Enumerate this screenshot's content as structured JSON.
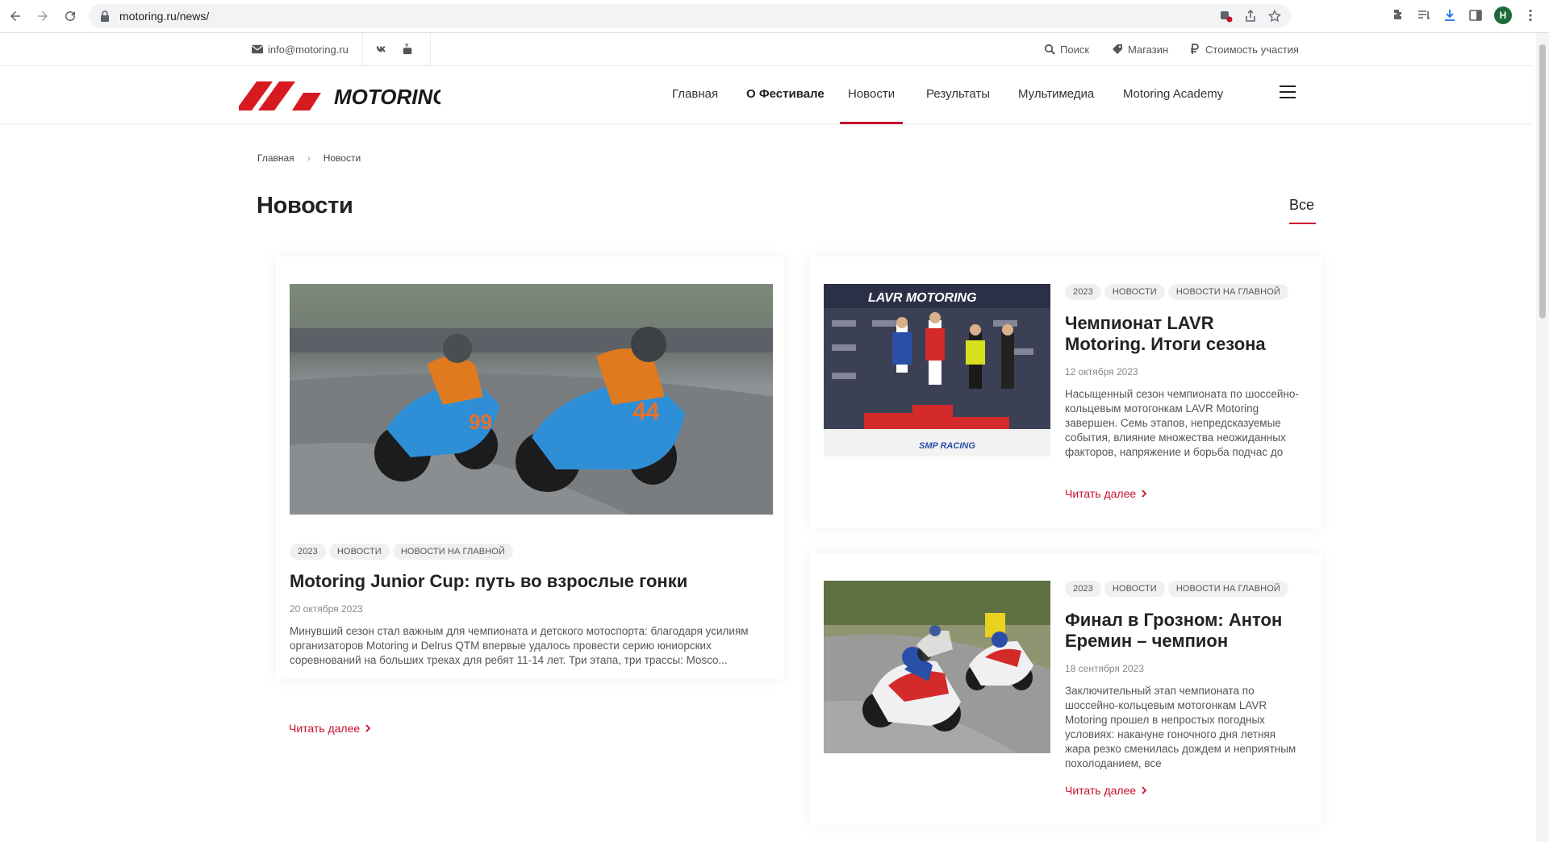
{
  "browser": {
    "url": "motoring.ru/news/",
    "profile_initial": "H"
  },
  "topbar": {
    "email": "info@motoring.ru",
    "search_label": "Поиск",
    "shop_label": "Магазин",
    "price_label": "Стоимость участия"
  },
  "header": {
    "logo_text": "MOTORING",
    "menu": [
      {
        "label": "Главная"
      },
      {
        "label": "О Фестивале"
      },
      {
        "label": "Новости"
      },
      {
        "label": "Результаты"
      },
      {
        "label": "Мультимедиа"
      },
      {
        "label": "Motoring Academy"
      }
    ]
  },
  "breadcrumb": {
    "home": "Главная",
    "separator": "›",
    "current": "Новости"
  },
  "page": {
    "title": "Новости",
    "filter_label": "Все"
  },
  "news": [
    {
      "tags": [
        "2023",
        "НОВОСТИ",
        "НОВОСТИ НА ГЛАВНОЙ"
      ],
      "title": "Motoring Junior Cup: путь во взрослые гонки",
      "date": "20 октября 2023",
      "text": "Минувший сезон стал важным для чемпионата и детского мотоспорта: благодаря усилиям организаторов Motoring и Delrus QTM впервые удалось провести серию юниорских соревнований на больших треках для ребят 11-14 лет. Три этапа, три трассы: Mosco...",
      "read_more": "Читать далее"
    },
    {
      "tags": [
        "2023",
        "НОВОСТИ",
        "НОВОСТИ НА ГЛАВНОЙ"
      ],
      "title": "Чемпионат LAVR Motoring. Итоги сезона",
      "date": "12 октября 2023",
      "text": "Насыщенный сезон чемпионата по шоссейно-кольцевым мотогонкам LAVR Motoring завершен. Семь этапов, непредсказуемые события, влияние множества неожиданных факторов, напряжение и борьба подчас до",
      "read_more": "Читать далее"
    },
    {
      "tags": [
        "2023",
        "НОВОСТИ",
        "НОВОСТИ НА ГЛАВНОЙ"
      ],
      "title": "Финал в Грозном: Антон Еремин – чемпион",
      "date": "18 сентября 2023",
      "text": "Заключительный этап чемпионата по шоссейно-кольцевым мотогонкам LAVR Motoring прошел в непростых погодных условиях: накануне гоночного дня летняя жара резко сменилась дождем и неприятным похолоданием, все",
      "read_more": "Читать далее"
    }
  ],
  "photo_text": {
    "podium_banner": "LAVR MOTORING",
    "podium_sponsor": "SMP RACING",
    "bike_number_1": "99",
    "bike_number_2": "44"
  },
  "colors": {
    "accent": "#c8102e",
    "tag_bg": "#f0f0f0"
  }
}
